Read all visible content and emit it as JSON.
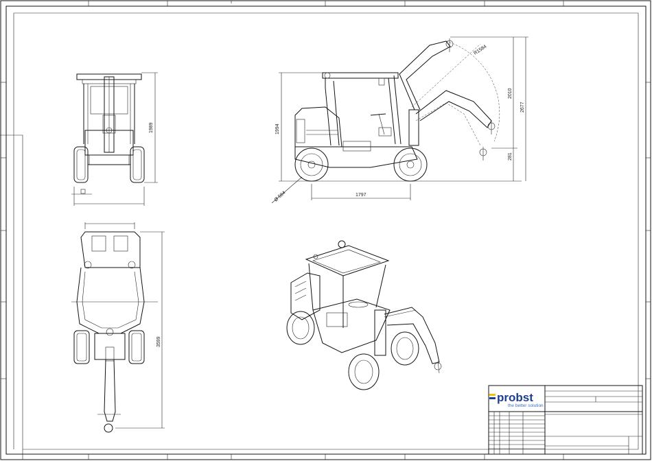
{
  "drawing": {
    "dimensions": {
      "front_height": "1989",
      "side_height": "1994",
      "arm_height": "2010",
      "reach_height": "2677",
      "arm_radius": "R1584",
      "wheel_diameter": "Ø 584",
      "wheelbase": "1797",
      "ground_clearance": "281",
      "top_length": "3599"
    }
  },
  "title_block": {
    "logo_text": "probst",
    "tagline": "the better solution",
    "accent_colors": [
      "#f2c200",
      "#1d3f8f"
    ]
  }
}
